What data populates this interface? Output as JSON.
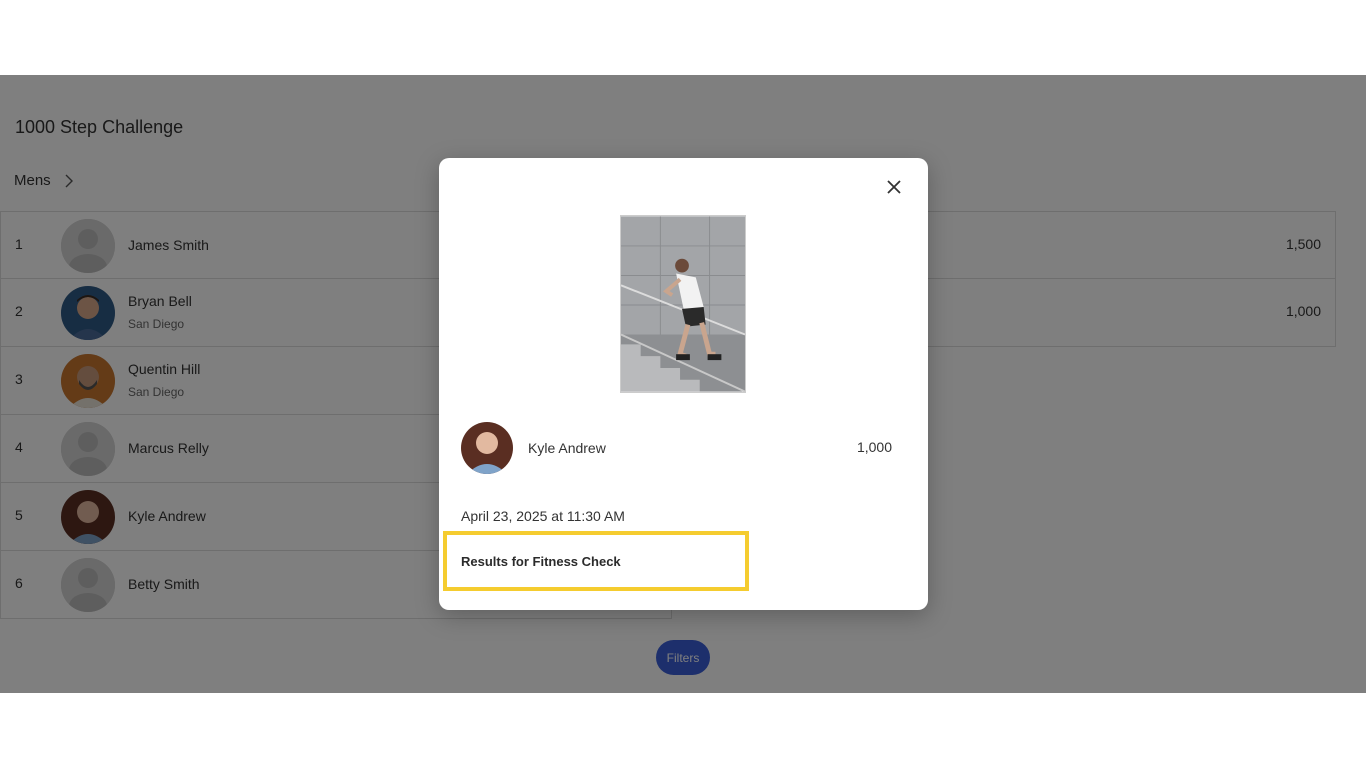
{
  "challenge": {
    "title": "1000 Step Challenge",
    "category": "Mens"
  },
  "leaderboard": [
    {
      "rank": "1",
      "name": "James Smith",
      "location": "",
      "score": "1,500",
      "avatar": "placeholder"
    },
    {
      "rank": "2",
      "name": "Bryan Bell",
      "location": "San Diego",
      "score": "1,000",
      "avatar": "photo"
    },
    {
      "rank": "3",
      "name": "Quentin Hill",
      "location": "San Diego",
      "score": "",
      "avatar": "photo"
    },
    {
      "rank": "4",
      "name": "Marcus Relly",
      "location": "",
      "score": "",
      "avatar": "placeholder"
    },
    {
      "rank": "5",
      "name": "Kyle Andrew",
      "location": "",
      "score": "",
      "avatar": "photo"
    },
    {
      "rank": "6",
      "name": "Betty Smith",
      "location": "",
      "score": "",
      "avatar": "placeholder"
    }
  ],
  "filters_label": "Filters",
  "modal": {
    "name": "Kyle Andrew",
    "score": "1,000",
    "date": "April 23, 2025 at 11:30 AM",
    "note": "Results for Fitness Check"
  },
  "colors": {
    "highlight": "#f5cc2f",
    "filters_button": "#3a5fd9",
    "overlay": "rgba(0,0,0,0.5)"
  },
  "icons": [
    "chevron-right-icon",
    "close-icon",
    "user-placeholder-icon"
  ]
}
